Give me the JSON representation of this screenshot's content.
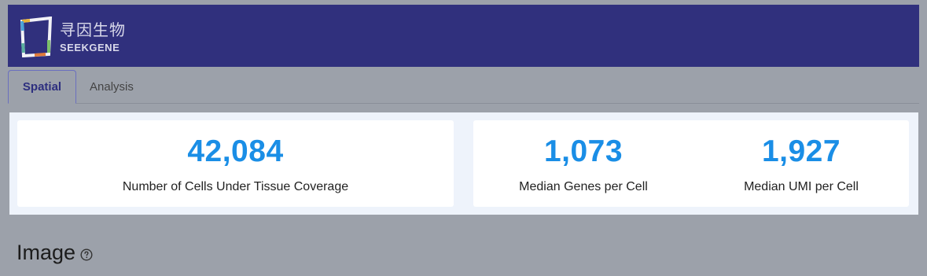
{
  "header": {
    "logo": {
      "chinese_name": "寻因生物",
      "english_name": "SEEKGENE"
    }
  },
  "tabs": [
    {
      "label": "Spatial",
      "active": true
    },
    {
      "label": "Analysis",
      "active": false
    }
  ],
  "metrics": {
    "cells": {
      "value": "42,084",
      "label": "Number of Cells Under Tissue Coverage"
    },
    "genes": {
      "value": "1,073",
      "label": "Median Genes per Cell"
    },
    "umi": {
      "value": "1,927",
      "label": "Median UMI per Cell"
    }
  },
  "section": {
    "title": "Image",
    "help_icon": "help-circle-icon"
  },
  "colors": {
    "header_bg": "#30307d",
    "metric_value": "#1a8ee6",
    "active_tab": "#2d2f7f"
  }
}
